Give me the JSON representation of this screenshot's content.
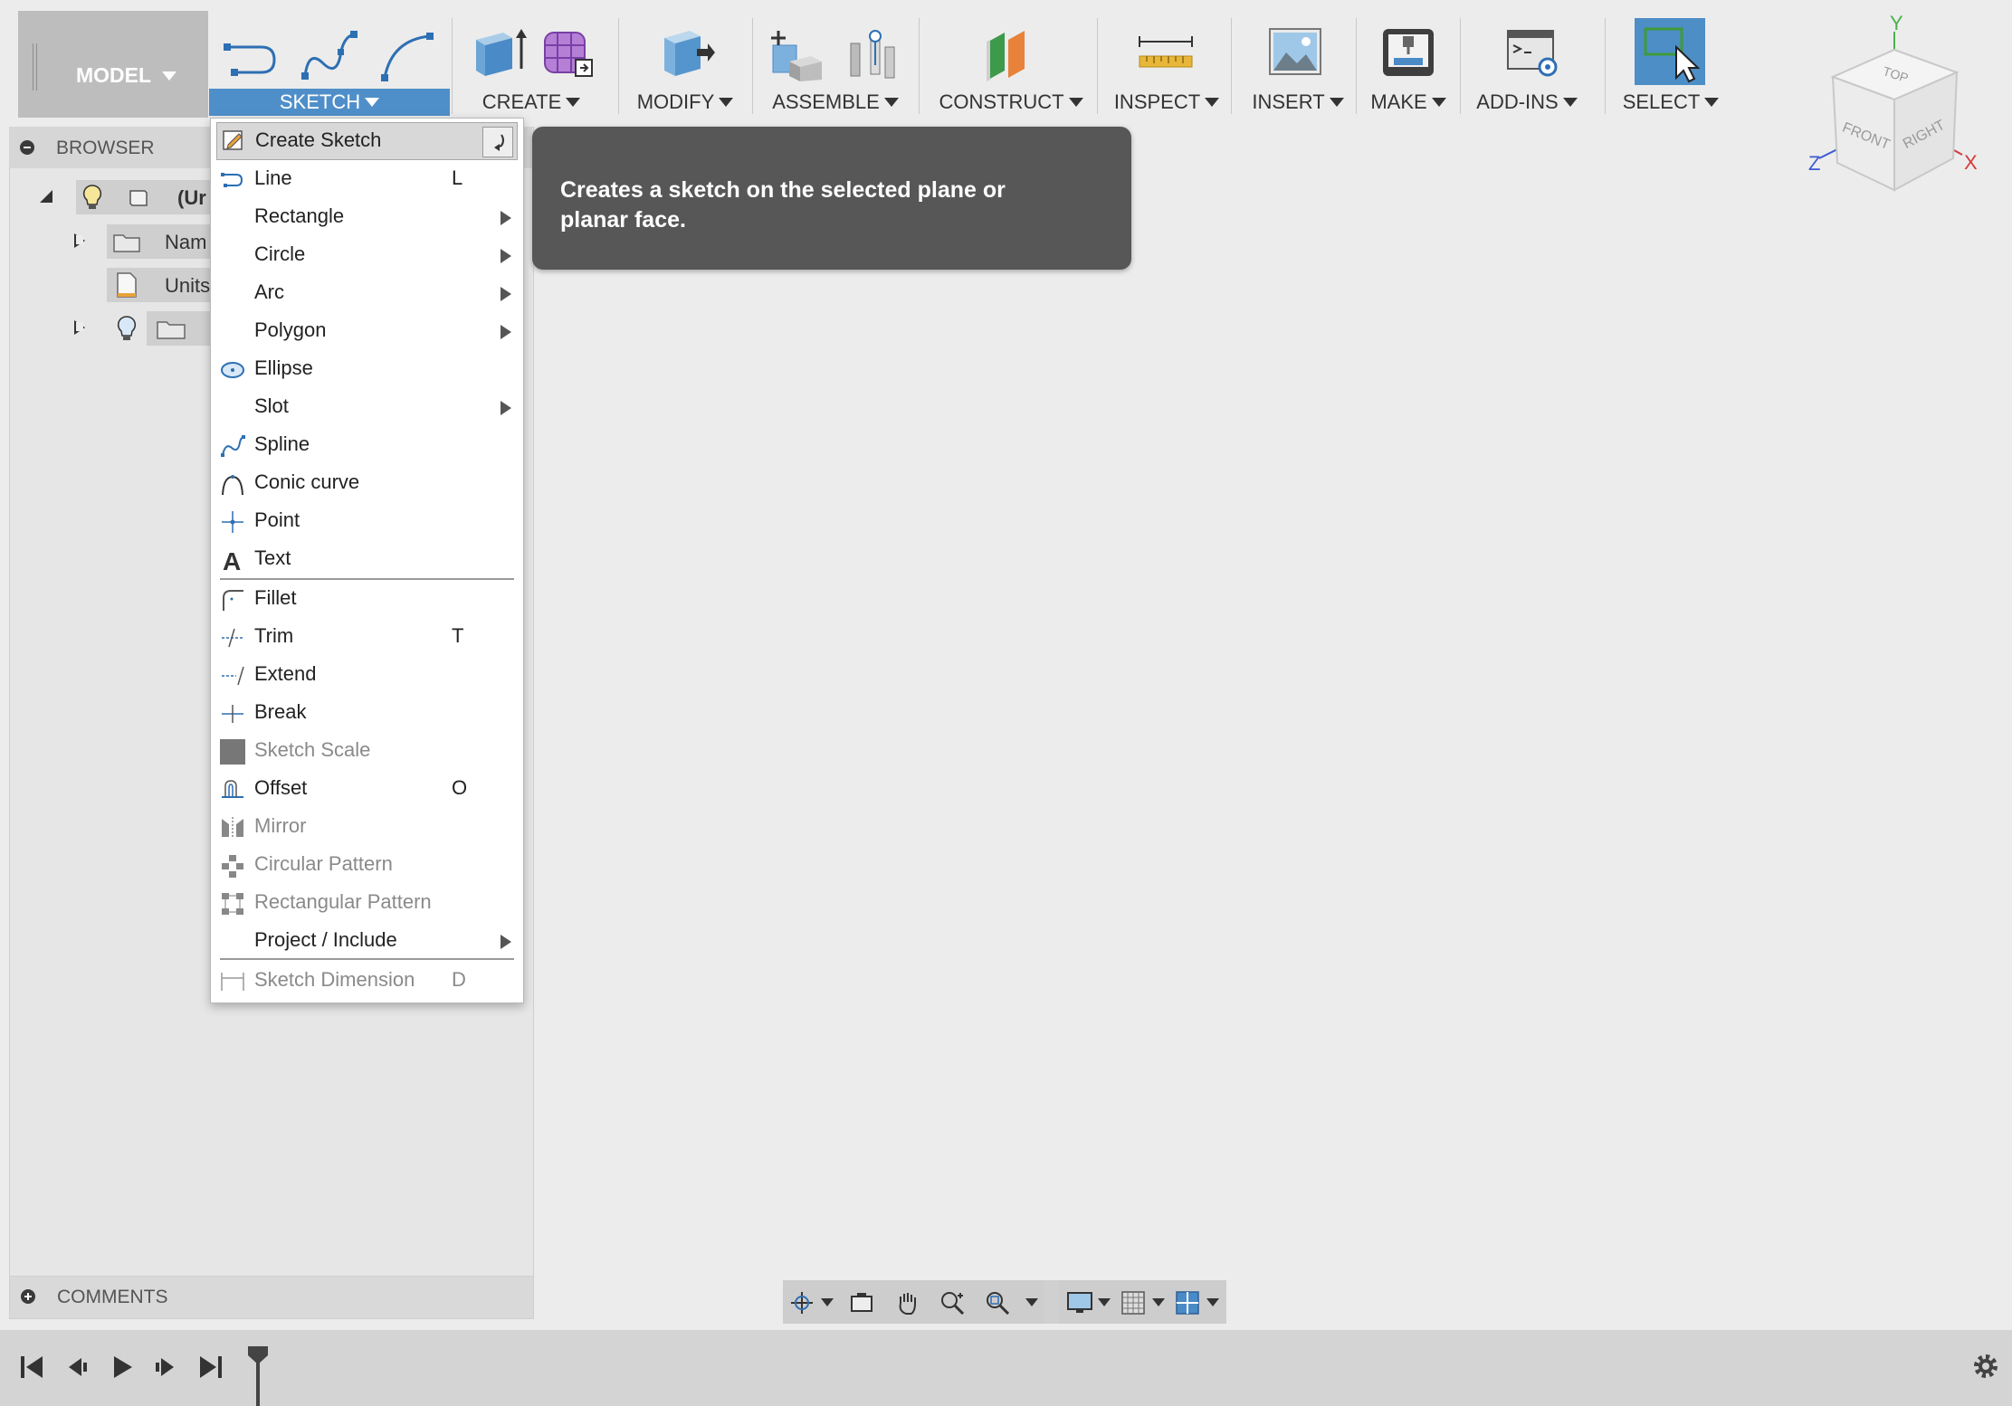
{
  "toolbar": {
    "workspace_label": "MODEL",
    "groups": [
      {
        "label": "SKETCH"
      },
      {
        "label": "CREATE"
      },
      {
        "label": "MODIFY"
      },
      {
        "label": "ASSEMBLE"
      },
      {
        "label": "CONSTRUCT"
      },
      {
        "label": "INSPECT"
      },
      {
        "label": "INSERT"
      },
      {
        "label": "MAKE"
      },
      {
        "label": "ADD-INS"
      },
      {
        "label": "SELECT"
      }
    ]
  },
  "browser": {
    "title": "BROWSER",
    "items": [
      {
        "label": "(Ur"
      },
      {
        "label": "Nam"
      },
      {
        "label": "Units"
      }
    ]
  },
  "comments": {
    "title": "COMMENTS"
  },
  "sketch_menu": {
    "items": [
      {
        "label": "Create Sketch",
        "shortcut": "",
        "submenu": false,
        "enabled": true,
        "icon": "create-sketch-icon"
      },
      {
        "label": "Line",
        "shortcut": "L",
        "submenu": false,
        "enabled": true,
        "icon": "line-icon"
      },
      {
        "label": "Rectangle",
        "shortcut": "",
        "submenu": true,
        "enabled": true,
        "icon": ""
      },
      {
        "label": "Circle",
        "shortcut": "",
        "submenu": true,
        "enabled": true,
        "icon": ""
      },
      {
        "label": "Arc",
        "shortcut": "",
        "submenu": true,
        "enabled": true,
        "icon": ""
      },
      {
        "label": "Polygon",
        "shortcut": "",
        "submenu": true,
        "enabled": true,
        "icon": ""
      },
      {
        "label": "Ellipse",
        "shortcut": "",
        "submenu": false,
        "enabled": true,
        "icon": "ellipse-icon"
      },
      {
        "label": "Slot",
        "shortcut": "",
        "submenu": true,
        "enabled": true,
        "icon": ""
      },
      {
        "label": "Spline",
        "shortcut": "",
        "submenu": false,
        "enabled": true,
        "icon": "spline-icon"
      },
      {
        "label": "Conic curve",
        "shortcut": "",
        "submenu": false,
        "enabled": true,
        "icon": "conic-curve-icon"
      },
      {
        "label": "Point",
        "shortcut": "",
        "submenu": false,
        "enabled": true,
        "icon": "point-icon"
      },
      {
        "label": "Text",
        "shortcut": "",
        "submenu": false,
        "enabled": true,
        "icon": "text-icon"
      },
      {
        "label": "Fillet",
        "shortcut": "",
        "submenu": false,
        "enabled": true,
        "icon": "fillet-icon"
      },
      {
        "label": "Trim",
        "shortcut": "T",
        "submenu": false,
        "enabled": true,
        "icon": "trim-icon"
      },
      {
        "label": "Extend",
        "shortcut": "",
        "submenu": false,
        "enabled": true,
        "icon": "extend-icon"
      },
      {
        "label": "Break",
        "shortcut": "",
        "submenu": false,
        "enabled": true,
        "icon": "break-icon"
      },
      {
        "label": "Sketch Scale",
        "shortcut": "",
        "submenu": false,
        "enabled": false,
        "icon": "sketch-scale-icon"
      },
      {
        "label": "Offset",
        "shortcut": "O",
        "submenu": false,
        "enabled": true,
        "icon": "offset-icon"
      },
      {
        "label": "Mirror",
        "shortcut": "",
        "submenu": false,
        "enabled": false,
        "icon": "mirror-icon"
      },
      {
        "label": "Circular Pattern",
        "shortcut": "",
        "submenu": false,
        "enabled": false,
        "icon": "circular-pattern-icon"
      },
      {
        "label": "Rectangular Pattern",
        "shortcut": "",
        "submenu": false,
        "enabled": false,
        "icon": "rectangular-pattern-icon"
      },
      {
        "label": "Project / Include",
        "shortcut": "",
        "submenu": true,
        "enabled": true,
        "icon": ""
      },
      {
        "label": "Sketch Dimension",
        "shortcut": "D",
        "submenu": false,
        "enabled": false,
        "icon": "sketch-dimension-icon"
      }
    ]
  },
  "tooltip": {
    "text": "Creates a sketch on the selected plane or planar face."
  },
  "viewcube": {
    "top": "TOP",
    "front": "FRONT",
    "right": "RIGHT",
    "axis_x": "X",
    "axis_y": "Y",
    "axis_z": "Z"
  },
  "colors": {
    "accent": "#4f8fc9",
    "tooltip_bg": "#575757",
    "select_active": "#4d8ec6"
  }
}
